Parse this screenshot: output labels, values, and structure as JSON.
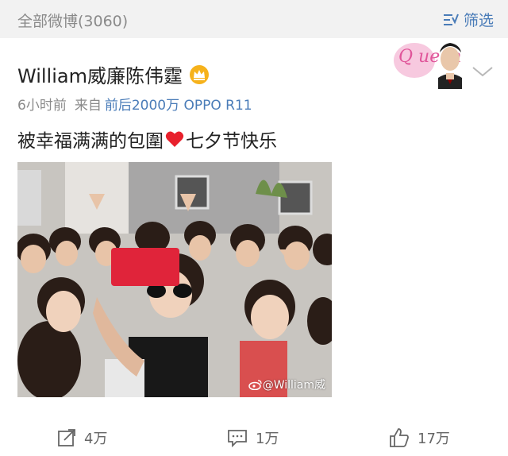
{
  "topbar": {
    "count_label": "全部微博(3060)",
    "filter_label": "筛选",
    "filter_icon": "filter-icon"
  },
  "post": {
    "username": "William威廉陈伟霆",
    "badge_icon": "crown-badge-icon",
    "time": "6小时前",
    "source_label": "来自",
    "device": "前后2000万 OPPO R11",
    "text_before": "被幸福满满的包圍",
    "heart_icon": "heart-icon",
    "text_after": "七夕节快乐",
    "watermark": "@William威",
    "avatar_text": "Q ueen"
  },
  "actions": {
    "repost_count": "4万",
    "comment_count": "1万",
    "like_count": "17万"
  },
  "colors": {
    "link_blue": "#4a7cb8",
    "phone_red": "#e0243a",
    "heart_red": "#e8202c"
  }
}
